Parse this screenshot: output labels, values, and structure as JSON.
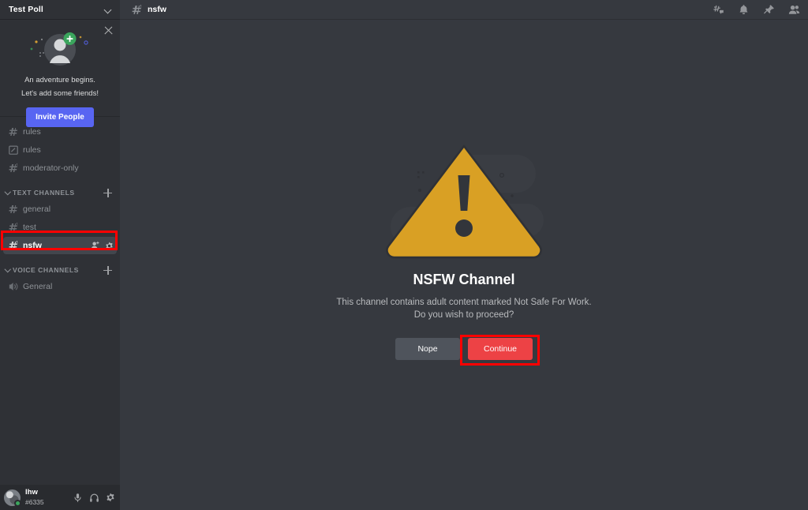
{
  "server": {
    "name": "Test Poll",
    "dropdown_icon": "chevron-down-icon"
  },
  "invite_card": {
    "close_icon": "close-icon",
    "art_icon": "add-friend-avatar-illustration",
    "line1": "An adventure begins.",
    "line2": "Let's add some friends!",
    "button_label": "Invite People",
    "button_color": "#5865f2"
  },
  "channels": {
    "ungrouped": [
      {
        "name": "rules",
        "icon": "hash-icon",
        "active": false
      },
      {
        "name": "rules",
        "icon": "rules-channel-icon",
        "active": false
      },
      {
        "name": "moderator-only",
        "icon": "hash-nsfw-icon",
        "active": false
      }
    ],
    "categories": [
      {
        "label": "TEXT CHANNELS",
        "collapse_icon": "chevron-down-icon",
        "add_icon": "plus-icon",
        "items": [
          {
            "name": "general",
            "icon": "hash-icon",
            "active": false
          },
          {
            "name": "test",
            "icon": "hash-nsfw-icon",
            "active": false
          },
          {
            "name": "nsfw",
            "icon": "hash-nsfw-icon",
            "active": true,
            "actions": [
              "invite-user-icon",
              "settings-gear-icon"
            ]
          }
        ]
      },
      {
        "label": "VOICE CHANNELS",
        "collapse_icon": "chevron-down-icon",
        "add_icon": "plus-icon",
        "items": [
          {
            "name": "General",
            "icon": "speaker-icon",
            "active": false
          }
        ]
      }
    ]
  },
  "user_panel": {
    "avatar_icon": "user-avatar",
    "status": "online",
    "status_color": "#3ba55d",
    "username": "lhw",
    "discriminator": "#6335",
    "actions": [
      {
        "icon": "microphone-icon"
      },
      {
        "icon": "headphones-icon"
      },
      {
        "icon": "settings-gear-icon"
      }
    ]
  },
  "top_bar": {
    "channel_icon": "hash-nsfw-icon",
    "channel_name": "nsfw",
    "actions": [
      {
        "icon": "threads-icon"
      },
      {
        "icon": "bell-icon"
      },
      {
        "icon": "pin-icon"
      },
      {
        "icon": "members-icon"
      }
    ]
  },
  "nsfw_gate": {
    "art_icon": "warning-triangle-icon",
    "warning_color": "#d9a024",
    "title": "NSFW Channel",
    "desc_line1": "This channel contains adult content marked Not Safe For Work.",
    "desc_line2": "Do you wish to proceed?",
    "nope_label": "Nope",
    "continue_label": "Continue",
    "continue_color": "#ed4245",
    "nope_color": "#4f545c"
  },
  "annotations": [
    {
      "target": "nsfw channel row",
      "color": "#ff0000"
    },
    {
      "target": "continue button",
      "color": "#ff0000"
    }
  ]
}
